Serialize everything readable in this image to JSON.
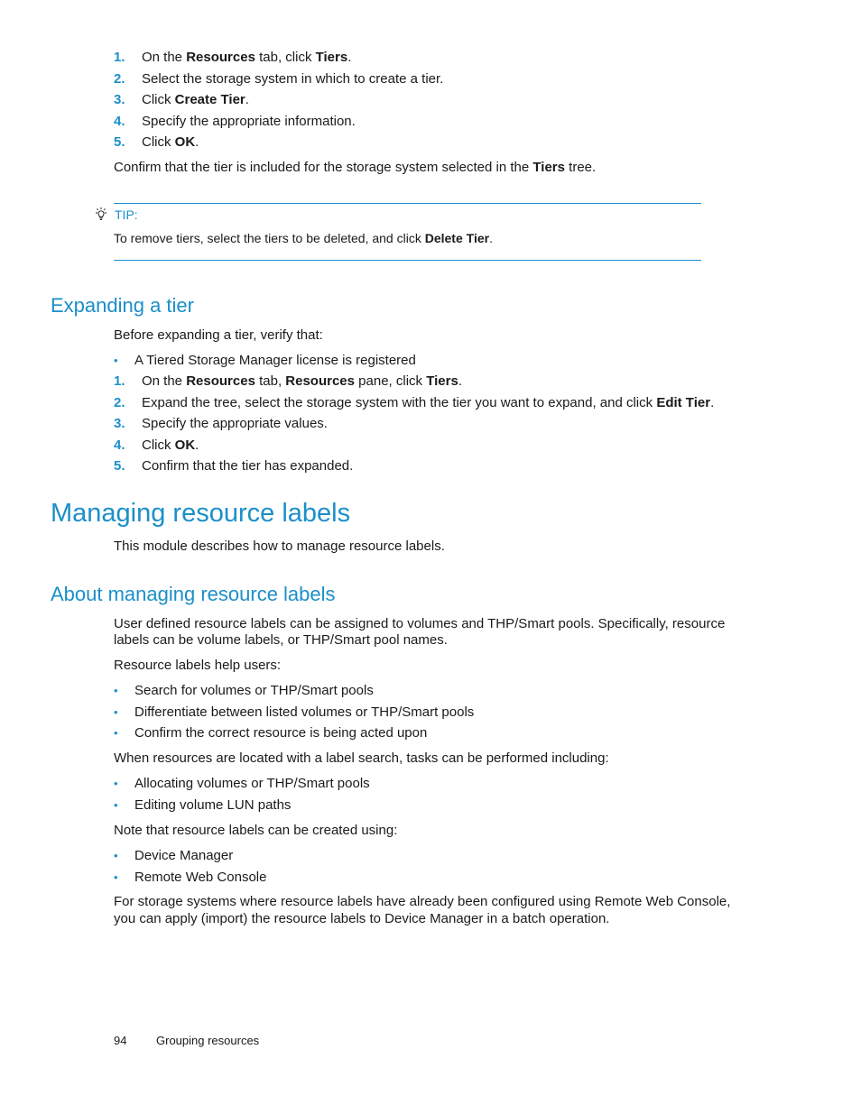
{
  "create_tier_steps": [
    {
      "n": "1.",
      "parts": [
        {
          "t": "On the "
        },
        {
          "b": "Resources"
        },
        {
          "t": " tab, click "
        },
        {
          "b": "Tiers"
        },
        {
          "t": "."
        }
      ]
    },
    {
      "n": "2.",
      "parts": [
        {
          "t": "Select the storage system in which to create a tier."
        }
      ]
    },
    {
      "n": "3.",
      "parts": [
        {
          "t": "Click "
        },
        {
          "b": "Create Tier"
        },
        {
          "t": "."
        }
      ]
    },
    {
      "n": "4.",
      "parts": [
        {
          "t": "Specify the appropriate information."
        }
      ]
    },
    {
      "n": "5.",
      "parts": [
        {
          "t": "Click "
        },
        {
          "b": "OK"
        },
        {
          "t": "."
        }
      ]
    }
  ],
  "confirm_text": [
    {
      "t": "Confirm that the tier is included for the storage system selected in the "
    },
    {
      "b": "Tiers"
    },
    {
      "t": " tree."
    }
  ],
  "tip": {
    "icon": "lightbulb-icon",
    "label": "TIP:",
    "text": [
      {
        "t": "To remove tiers, select the tiers to be deleted, and click "
      },
      {
        "b": "Delete Tier"
      },
      {
        "t": "."
      }
    ]
  },
  "expanding": {
    "heading": "Expanding a tier",
    "intro": "Before expanding a tier, verify that:",
    "bullets": [
      "A Tiered Storage Manager license is registered"
    ],
    "steps": [
      {
        "n": "1.",
        "parts": [
          {
            "t": "On the "
          },
          {
            "b": "Resources"
          },
          {
            "t": " tab, "
          },
          {
            "b": "Resources"
          },
          {
            "t": " pane, click "
          },
          {
            "b": "Tiers"
          },
          {
            "t": "."
          }
        ]
      },
      {
        "n": "2.",
        "parts": [
          {
            "t": "Expand the tree, select the storage system with the tier you want to expand, and click "
          },
          {
            "b": "Edit Tier"
          },
          {
            "t": "."
          }
        ]
      },
      {
        "n": "3.",
        "parts": [
          {
            "t": "Specify the appropriate values."
          }
        ]
      },
      {
        "n": "4.",
        "parts": [
          {
            "t": "Click "
          },
          {
            "b": "OK"
          },
          {
            "t": "."
          }
        ]
      },
      {
        "n": "5.",
        "parts": [
          {
            "t": "Confirm that the tier has expanded."
          }
        ]
      }
    ]
  },
  "managing": {
    "heading": "Managing resource labels",
    "intro": "This module describes how to manage resource labels."
  },
  "about": {
    "heading": "About managing resource labels",
    "para1_line1": "User defined resource labels can be assigned to volumes and THP/Smart pools. Specifically, resource",
    "para1_line2": "labels can be volume labels, or THP/Smart pool names.",
    "help_intro": "Resource labels help users:",
    "help_bullets": [
      "Search for volumes or THP/Smart pools",
      "Differentiate between listed volumes or THP/Smart pools",
      "Confirm the correct resource is being acted upon"
    ],
    "tasks_intro": "When resources are located with a label search, tasks can be performed including:",
    "tasks_bullets": [
      "Allocating volumes or THP/Smart pools",
      "Editing volume LUN paths"
    ],
    "created_intro": "Note that resource labels can be created using:",
    "created_bullets": [
      "Device Manager",
      "Remote Web Console"
    ],
    "final_line1": "For storage systems where resource labels have already been configured using Remote Web Console,",
    "final_line2": "you can apply (import) the resource labels to Device Manager in a batch operation."
  },
  "footer": {
    "page_number": "94",
    "section": "Grouping resources"
  }
}
